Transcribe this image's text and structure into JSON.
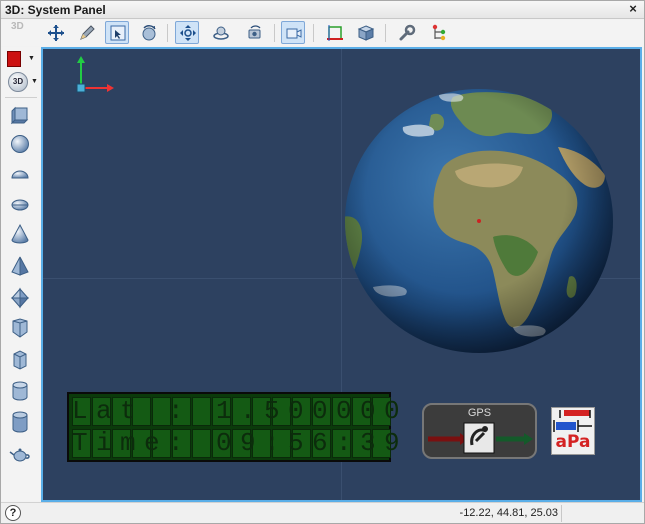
{
  "window": {
    "title": "3D: System Panel",
    "close_glyph": "×"
  },
  "toolbar": {
    "label_3d": "3D",
    "buttons": [
      {
        "name": "move-view-icon"
      },
      {
        "name": "pencil-icon"
      },
      {
        "name": "select-tool-icon",
        "active": true
      },
      {
        "name": "rotate-sphere-icon"
      },
      {
        "name": "pan-icon",
        "active": true
      },
      {
        "name": "orbit-icon"
      },
      {
        "name": "camera-rotate-icon"
      },
      {
        "name": "camera-view-icon",
        "active": true
      },
      {
        "name": "bounding-box-icon"
      },
      {
        "name": "cube-icon"
      },
      {
        "name": "wrench-icon"
      },
      {
        "name": "scene-tree-icon"
      }
    ]
  },
  "sidebar": {
    "color_accent": "#cc1111",
    "mode_label": "3D",
    "shapes": [
      "box-icon",
      "sphere-icon",
      "ellipsoid-icon",
      "half-ellipsoid-icon",
      "cone-icon",
      "pyramid-icon",
      "octahedron-icon",
      "prism-icon",
      "hexagonal-prism-icon",
      "cylinder-icon",
      "cylinder-tall-icon",
      "teapot-icon"
    ]
  },
  "viewport": {
    "background": "#2d4160",
    "lcd": {
      "row1": "Lat : 1.500000",
      "row2": "Time: 09:56:39"
    },
    "gps_label": "GPS",
    "apa_text": "aPa"
  },
  "status": {
    "help_glyph": "?",
    "coordinates": "-12.22, 44.81, 25.03"
  }
}
